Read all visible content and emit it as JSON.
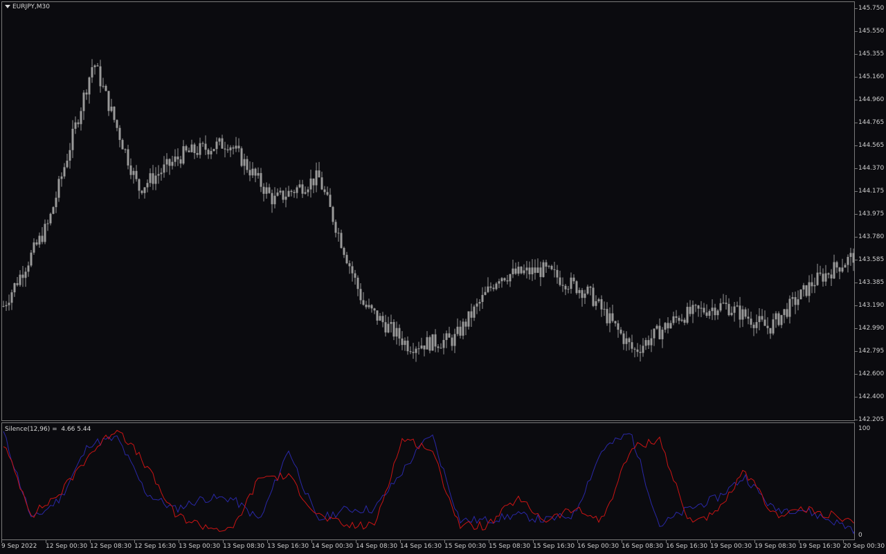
{
  "chart": {
    "symbol": "EURJPY,M30",
    "price_axis": [
      "145.750",
      "145.550",
      "145.355",
      "145.160",
      "144.960",
      "144.765",
      "144.565",
      "144.370",
      "144.175",
      "143.975",
      "143.780",
      "143.585",
      "143.385",
      "143.190",
      "142.990",
      "142.795",
      "142.600",
      "142.400",
      "142.205"
    ],
    "time_axis": [
      "9 Sep 2022",
      "12 Sep 00:30",
      "12 Sep 08:30",
      "12 Sep 16:30",
      "13 Sep 00:30",
      "13 Sep 08:30",
      "13 Sep 16:30",
      "14 Sep 00:30",
      "14 Sep 08:30",
      "14 Sep 16:30",
      "15 Sep 00:30",
      "15 Sep 08:30",
      "15 Sep 16:30",
      "16 Sep 00:30",
      "16 Sep 08:30",
      "16 Sep 16:30",
      "19 Sep 00:30",
      "19 Sep 08:30",
      "19 Sep 16:30",
      "20 Sep 00:30"
    ],
    "candle_color": "#9a9a9a",
    "background": "#0b0b0f"
  },
  "indicator": {
    "name": "Silence(12,96)",
    "values_text": "4.66 5.44",
    "levels": [
      "100",
      "0"
    ],
    "line_colors": {
      "blue": "#2a28a8",
      "red": "#cc1414"
    }
  },
  "chart_data": [
    {
      "type": "candlestick",
      "title": "EURJPY,M30",
      "ylim": [
        142.205,
        145.75
      ],
      "approx_close_path": [
        [
          "9 Sep 2022",
          143.19
        ],
        [
          "12 Sep 00:30",
          143.9
        ],
        [
          "12 Sep 08:30",
          145.3
        ],
        [
          "12 Sep 16:30",
          144.2
        ],
        [
          "13 Sep 00:30",
          144.5
        ],
        [
          "13 Sep 08:30",
          144.6
        ],
        [
          "13 Sep 16:30",
          144.1
        ],
        [
          "14 Sep 00:30",
          144.3
        ],
        [
          "14 Sep 08:30",
          143.2
        ],
        [
          "14 Sep 16:30",
          142.85
        ],
        [
          "15 Sep 00:30",
          142.9
        ],
        [
          "15 Sep 08:30",
          143.45
        ],
        [
          "15 Sep 16:30",
          143.5
        ],
        [
          "16 Sep 00:30",
          143.3
        ],
        [
          "16 Sep 08:30",
          142.8
        ],
        [
          "16 Sep 16:30",
          143.1
        ],
        [
          "19 Sep 00:30",
          143.2
        ],
        [
          "19 Sep 08:30",
          143.0
        ],
        [
          "19 Sep 16:30",
          143.4
        ],
        [
          "20 Sep 00:30",
          143.65
        ]
      ]
    },
    {
      "type": "line",
      "title": "Silence(12,96)",
      "ylim": [
        0,
        100
      ],
      "series": [
        {
          "name": "blue",
          "values": [
            95,
            15,
            35,
            85,
            90,
            40,
            25,
            35,
            35,
            15,
            80,
            15,
            25,
            25,
            60,
            95,
            15,
            15,
            20,
            15,
            20,
            80,
            95,
            10,
            25,
            35,
            55,
            25,
            25,
            15,
            5
          ]
        },
        {
          "name": "red",
          "values": [
            85,
            20,
            40,
            75,
            100,
            65,
            20,
            10,
            5,
            55,
            55,
            20,
            10,
            10,
            90,
            80,
            10,
            10,
            35,
            15,
            25,
            15,
            80,
            90,
            15,
            20,
            60,
            20,
            25,
            20,
            10
          ]
        }
      ]
    }
  ]
}
